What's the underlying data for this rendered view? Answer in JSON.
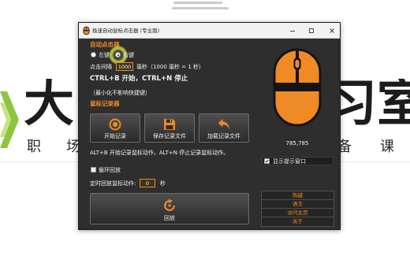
{
  "window": {
    "title": "极速自动鼠标点击器 (专业版)",
    "app_icon": "mouse-icon",
    "controls": {
      "minimize": "minimize-icon",
      "maximize": "maximize-icon",
      "close": "close-icon"
    }
  },
  "auto_clicker": {
    "heading": "自动点击器",
    "radio_left_label": "左键",
    "radio_right_label": "右键",
    "left_selected": false,
    "right_selected": true,
    "interval_label": "点击间隔",
    "interval_value": "1000",
    "interval_unit": "毫秒（1000 毫秒 = 1 秒）",
    "hotkeys": "CTRL+B 开始，CTRL+N 停止",
    "hotkey_note": "（最小化不影响快捷键）"
  },
  "recorder": {
    "heading": "鼠标记录器",
    "buttons": [
      {
        "label": "开始记录",
        "icon": "record-icon"
      },
      {
        "label": "保存记录文件",
        "icon": "save-icon"
      },
      {
        "label": "加载记录文件",
        "icon": "load-icon"
      }
    ],
    "hotkeys": "ALT+B 开始记录鼠标动作，ALT+N 停止记录鼠标动作。",
    "loop_label": "循环回放",
    "loop_checked": false,
    "timer_label": "定时回放鼠标动作:",
    "timer_value": "0",
    "timer_unit": "秒",
    "playback_label": "回放",
    "playback_icon": "replay-icon"
  },
  "side": {
    "logo_icon": "mouse-logo-icon",
    "cursor_position": "785,785",
    "show_tip_label": "显示提示窗口",
    "show_tip_checked": true,
    "links": [
      "热键",
      "语言",
      "访问主页",
      "关于"
    ]
  },
  "desktop": {
    "big_left": "大",
    "big_right_1": "习",
    "big_right_2": "室",
    "small": [
      "职",
      "场",
      "备",
      "课"
    ]
  },
  "colors": {
    "accent": "#f08a24",
    "body_bg": "#2e2e2e",
    "text": "#f2f2f2",
    "titlebar_bg": "#f2f2f2",
    "brand_green": "#8cc63f"
  }
}
